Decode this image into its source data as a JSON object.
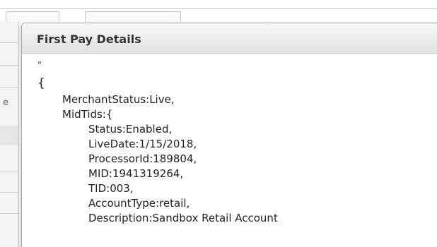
{
  "dialog": {
    "title": "First Pay Details"
  },
  "background": {
    "edge_letter": "e"
  },
  "details": {
    "quote": "\"",
    "open_brace": "{",
    "merchant_status_line": "MerchantStatus:Live,",
    "mid_tids_line": "MidTids:{",
    "mid_tid_lines": [
      "Status:Enabled,",
      "LiveDate:1/15/2018,",
      "ProcessorId:189804,",
      "MID:1941319264,",
      "TID:003,",
      "AccountType:retail,",
      "Description:Sandbox Retail Account"
    ]
  }
}
